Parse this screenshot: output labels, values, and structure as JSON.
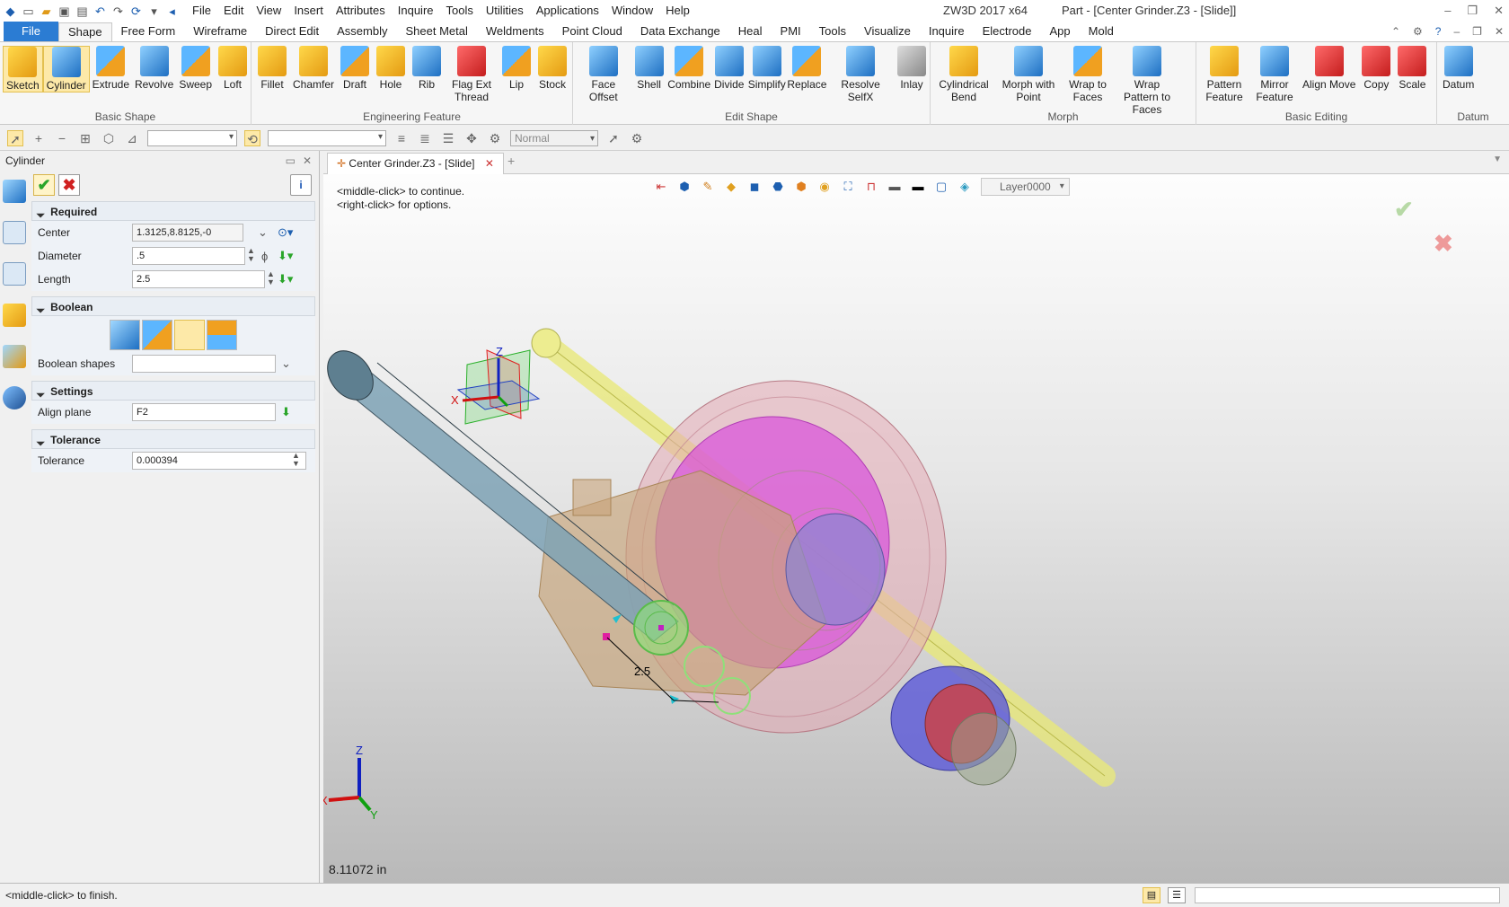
{
  "app": {
    "title": "ZW3D 2017  x64",
    "document": "Part - [Center Grinder.Z3 - [Slide]]",
    "menu": [
      "File",
      "Edit",
      "View",
      "Insert",
      "Attributes",
      "Inquire",
      "Tools",
      "Utilities",
      "Applications",
      "Window",
      "Help"
    ]
  },
  "ribbon_tabs": [
    "File",
    "Shape",
    "Free Form",
    "Wireframe",
    "Direct Edit",
    "Assembly",
    "Sheet Metal",
    "Weldments",
    "Point Cloud",
    "Data Exchange",
    "Heal",
    "PMI",
    "Tools",
    "Visualize",
    "Inquire",
    "Electrode",
    "App",
    "Mold"
  ],
  "active_tab": "Shape",
  "ribbon_groups": [
    {
      "label": "Basic Shape",
      "buttons": [
        "Sketch",
        "Cylinder",
        "Extrude",
        "Revolve",
        "Sweep",
        "Loft"
      ]
    },
    {
      "label": "Engineering Feature",
      "buttons": [
        "Fillet",
        "Chamfer",
        "Draft",
        "Hole",
        "Rib",
        "Flag Ext Thread",
        "Lip",
        "Stock"
      ]
    },
    {
      "label": "Edit Shape",
      "buttons": [
        "Face Offset",
        "Shell",
        "Combine",
        "Divide",
        "Simplify",
        "Replace",
        "Resolve SelfX",
        "Inlay"
      ]
    },
    {
      "label": "Morph",
      "buttons": [
        "Cylindrical Bend",
        "Morph with Point",
        "Wrap to Faces",
        "Wrap Pattern to Faces"
      ]
    },
    {
      "label": "Basic Editing",
      "buttons": [
        "Pattern Feature",
        "Mirror Feature",
        "Align Move",
        "Copy",
        "Scale"
      ]
    },
    {
      "label": "Datum",
      "buttons": [
        "Datum"
      ]
    }
  ],
  "toolbar2": {
    "filter_mode": "Normal"
  },
  "panel": {
    "title": "Cylinder",
    "sections": {
      "required": "Required",
      "boolean": "Boolean",
      "settings": "Settings",
      "tolerance": "Tolerance"
    },
    "fields": {
      "center_label": "Center",
      "center_value": "1.3125,8.8125,-0",
      "diameter_label": "Diameter",
      "diameter_value": ".5",
      "length_label": "Length",
      "length_value": "2.5",
      "boolean_shapes_label": "Boolean shapes",
      "boolean_shapes_value": "",
      "align_plane_label": "Align plane",
      "align_plane_value": "F2",
      "tolerance_label": "Tolerance",
      "tolerance_value": "0.000394"
    }
  },
  "viewport": {
    "tab_title": "Center Grinder.Z3 - [Slide]",
    "layer": "Layer0000",
    "prompt_line1": "<middle-click> to continue.",
    "prompt_line2": "<right-click> for options.",
    "dimension_label": "2.5",
    "readout": "8.11072 in",
    "axes": {
      "x": "X",
      "y": "Y",
      "z": "Z"
    }
  },
  "status": {
    "message": "<middle-click> to finish."
  },
  "colors": {
    "accent": "#2b7cd3",
    "highlight": "#fde9a8",
    "shaft": "#7fa2b3",
    "disk": "#e1a7b2",
    "rod": "#e6e67a"
  }
}
